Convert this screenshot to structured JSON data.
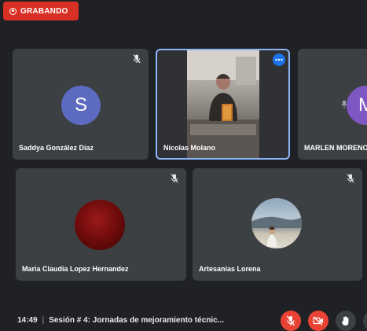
{
  "recording": {
    "label": "GRABANDO"
  },
  "tiles": {
    "t1": {
      "name": "Saddya González Díaz",
      "initial": "S"
    },
    "t2": {
      "name": "Nicolas Molano"
    },
    "t3": {
      "name": "MARLEN MORENO",
      "initial": "M"
    },
    "t4": {
      "name": "Maria Claudia Lopez Hernandez"
    },
    "t5": {
      "name": "Artesanias Lorena"
    }
  },
  "footer": {
    "time": "14:49",
    "title": "Sesión # 4: Jornadas de mejoramiento técnic..."
  },
  "colors": {
    "background": "#202124",
    "tile": "#3c4043",
    "avatar_s": "#5c6bc0",
    "avatar_m": "#7e57c2",
    "record": "#d93025",
    "control_red": "#ea4335",
    "control_dark": "#3c4043",
    "active_border": "#8ab4f8"
  },
  "icons": {
    "mic_off": "mic-off-icon",
    "cam_off": "camera-off-icon",
    "hand": "raise-hand-icon",
    "more": "more-options-icon",
    "pin": "pin-icon"
  }
}
